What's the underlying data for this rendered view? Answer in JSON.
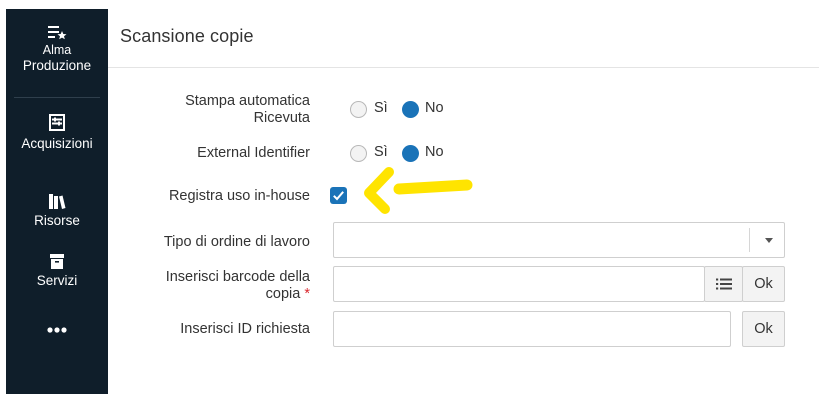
{
  "sidebar": {
    "items": [
      {
        "label_line1": "Alma",
        "label_line2": "Produzione",
        "icon": "list-star-icon"
      },
      {
        "label": "Acquisizioni",
        "icon": "abacus-icon"
      },
      {
        "label": "Risorse",
        "icon": "books-icon"
      },
      {
        "label": "Servizi",
        "icon": "archive-box-icon"
      },
      {
        "label": "",
        "icon": "more-dots-icon"
      }
    ]
  },
  "header": {
    "title": "Scansione copie"
  },
  "form": {
    "print_receipt": {
      "label_line1": "Stampa automatica",
      "label_line2": "Ricevuta",
      "option_yes": "Sì",
      "option_no": "No",
      "selected": "No"
    },
    "external_identifier": {
      "label": "External Identifier",
      "option_yes": "Sì",
      "option_no": "No",
      "selected": "No"
    },
    "register_inhouse": {
      "label": "Registra uso in-house",
      "checked": true
    },
    "work_order_type": {
      "label": "Tipo di ordine di lavoro",
      "value": ""
    },
    "item_barcode": {
      "label_line1": "Inserisci barcode della",
      "label_line2": "copia",
      "required_mark": "*",
      "value": "",
      "ok": "Ok"
    },
    "request_id": {
      "label": "Inserisci ID richiesta",
      "value": "",
      "ok": "Ok"
    }
  },
  "colors": {
    "sidebar_bg": "#0f1e2a",
    "accent": "#1a73b8",
    "annotation_arrow": "#ffe400",
    "required": "#d9272e"
  }
}
